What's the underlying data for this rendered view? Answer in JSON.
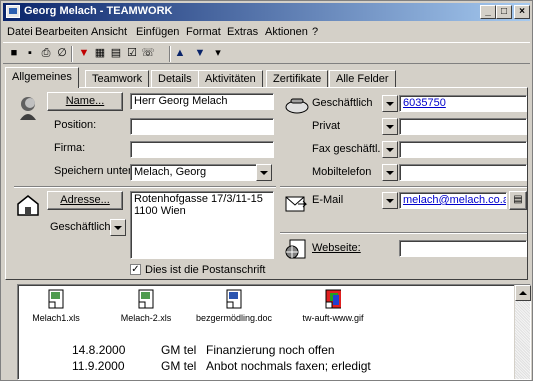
{
  "window": {
    "title": "Georg Melach - TEAMWORK"
  },
  "menu": [
    "Datei",
    "Bearbeiten",
    "Ansicht",
    "Einfügen",
    "Format",
    "Extras",
    "Aktionen",
    "?"
  ],
  "tabs": [
    "Allgemeines",
    "Teamwork",
    "Details",
    "Aktivitäten",
    "Zertifikate",
    "Alle Felder"
  ],
  "contact": {
    "name_button": "Name...",
    "name_value": "Herr Georg Melach",
    "position_label": "Position:",
    "position_value": "",
    "firma_label": "Firma:",
    "firma_value": "",
    "speichern_label": "Speichern unter:",
    "speichern_value": "Melach, Georg"
  },
  "phones": {
    "business_label": "Geschäftlich",
    "business_value": "6035750",
    "private_label": "Privat",
    "private_value": "",
    "fax_label": "Fax geschäftl.",
    "fax_value": "",
    "mobile_label": "Mobiltelefon",
    "mobile_value": ""
  },
  "address": {
    "button": "Adresse...",
    "type_label": "Geschäftlich",
    "line1": "Rotenhofgasse 17/3/11-15",
    "line2": "1100  Wien",
    "postal_checkbox_label": "Dies ist die Postanschrift"
  },
  "email": {
    "label": "E-Mail",
    "value": "melach@melach.co.at"
  },
  "web": {
    "label": "Webseite:",
    "value": ""
  },
  "attachments": [
    {
      "name": "Melach1.xls",
      "type": "xls"
    },
    {
      "name": "Melach-2.xls",
      "type": "xls"
    },
    {
      "name": "bezgermödling.doc",
      "type": "doc"
    },
    {
      "name": "tw-auft-www.gif",
      "type": "gif"
    }
  ],
  "notes": [
    {
      "date": "14.8.2000",
      "kind": "GM tel",
      "text": "Finanzierung noch offen"
    },
    {
      "date": "11.9.2000",
      "kind": "GM tel",
      "text": "Anbot nochmals faxen; erledigt"
    }
  ]
}
